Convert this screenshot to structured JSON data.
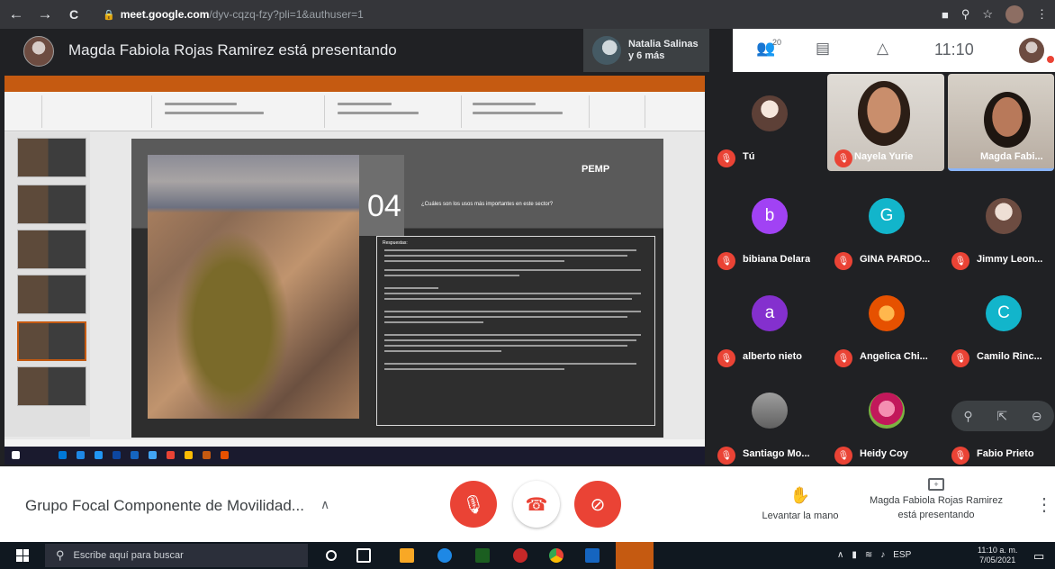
{
  "browser": {
    "url_host": "meet.google.com",
    "url_path": "/dyv-cqzq-fzy?pli=1&authuser=1",
    "back": "←",
    "forward": "→",
    "reload": "C"
  },
  "header": {
    "presenting_text": "Magda Fabiola Rojas Ramirez está presentando",
    "others_line1": "Natalia Salinas",
    "others_line2": "y 6 más",
    "participant_count": "20",
    "time": "11:10"
  },
  "slide": {
    "number": "04",
    "question": "¿Cuáles son los usos más importantes en este sector?",
    "logo": "PEMP",
    "box_heading": "Respuestas:"
  },
  "participants": [
    {
      "name": "Tú",
      "kind": "photo"
    },
    {
      "name": "Nayela Yurie",
      "kind": "video"
    },
    {
      "name": "Magda Fabi...",
      "kind": "video"
    },
    {
      "name": "bibiana Delara",
      "initial": "b",
      "color": "#a142f4"
    },
    {
      "name": "GINA PARDO...",
      "initial": "G",
      "color": "#12b5cb"
    },
    {
      "name": "Jimmy Leon...",
      "kind": "photo"
    },
    {
      "name": "alberto nieto",
      "initial": "a",
      "color": "#8430ce"
    },
    {
      "name": "Angelica Chi...",
      "kind": "photo"
    },
    {
      "name": "Camilo Rinc...",
      "initial": "C",
      "color": "#12b5cb"
    },
    {
      "name": "Santiago Mo...",
      "kind": "photo"
    },
    {
      "name": "Heidy Coy",
      "kind": "photo"
    },
    {
      "name": "Fabio Prieto",
      "kind": "mini"
    }
  ],
  "bottom": {
    "meeting_name": "Grupo Focal Componente de Movilidad...",
    "raise_hand": "Levantar la mano",
    "presenting_line1": "Magda Fabiola Rojas Ramirez",
    "presenting_line2": "está presentando",
    "colors": {
      "red": "#ea4335",
      "hangup_bg": "#ffffff"
    }
  },
  "windows": {
    "search_placeholder": "Escribe aquí para buscar",
    "lang": "ESP",
    "time": "11:10 a. m.",
    "date": "7/05/2021"
  }
}
